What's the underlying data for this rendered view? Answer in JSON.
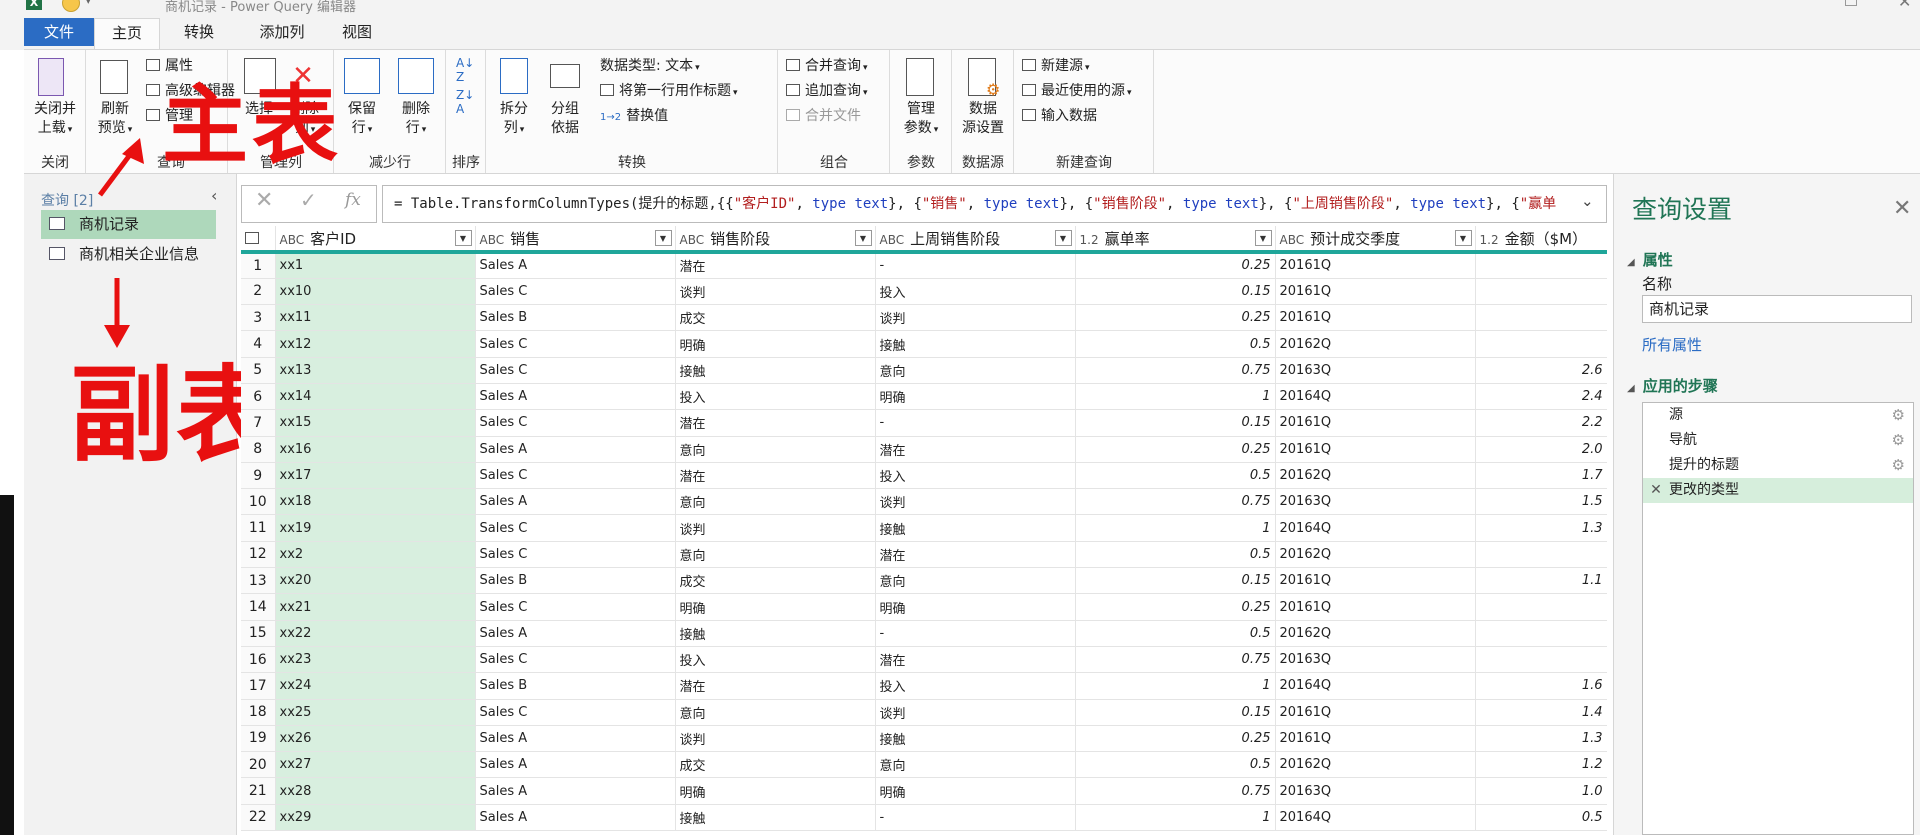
{
  "window": {
    "title": "商机记录 - Power Query 编辑器"
  },
  "tabs": {
    "file": "文件",
    "home": "主页",
    "transform": "转换",
    "add_column": "添加列",
    "view": "视图"
  },
  "ribbon": {
    "close_load": "关闭并",
    "close_load2": "上载",
    "close_group": "关闭",
    "refresh": "刷新",
    "refresh2": "预览",
    "properties": "属性",
    "advanced_editor": "高级编辑器",
    "manage": "管理",
    "choose_cols": "选择",
    "remove_cols": "删除",
    "remove_cols2": "列",
    "keep_rows": "保留",
    "keep_rows2": "行",
    "remove_rows": "删除",
    "remove_rows2": "行",
    "reduce_group": "减少行",
    "sort_group": "排序",
    "split": "拆分",
    "split2": "列",
    "group_by": "分组",
    "group_by2": "依据",
    "data_type": "数据类型: 文本",
    "first_row_header": "将第一行用作标题",
    "replace_values": "替换值",
    "transform_group": "转换",
    "merge_queries": "合并查询",
    "append_queries": "追加查询",
    "combine_files": "合并文件",
    "combine_group": "组合",
    "manage_params": "管理",
    "manage_params2": "参数",
    "params_group": "参数",
    "ds_settings": "数据",
    "ds_settings2": "源设置",
    "ds_group": "数据源",
    "new_source": "新建源",
    "recent_sources": "最近使用的源",
    "enter_data": "输入数据",
    "new_query_group": "新建查询",
    "query_group_partial": "查询",
    "manage_cols_partial": "管理列"
  },
  "annotations": {
    "main": "主表",
    "sub": "副表"
  },
  "queries": {
    "header": "查询 [2]",
    "items": [
      "商机记录",
      "商机相关企业信息"
    ]
  },
  "formula": {
    "prefix": "= Table.TransformColumnTypes(提升的标题,{{",
    "p1": "\"客户ID\"",
    "t1": "type text",
    "p2": "\"销售\"",
    "t2": "type text",
    "p3": "\"销售阶段\"",
    "t3": "type text",
    "p4": "\"上周销售阶段\"",
    "t4": "type text",
    "p5": "\"赢单"
  },
  "grid": {
    "columns": [
      {
        "type": "ABC",
        "name": "客户ID"
      },
      {
        "type": "ABC",
        "name": "销售"
      },
      {
        "type": "ABC",
        "name": "销售阶段"
      },
      {
        "type": "ABC",
        "name": "上周销售阶段"
      },
      {
        "type": "1.2",
        "name": "赢单率"
      },
      {
        "type": "ABC",
        "name": "预计成交季度"
      },
      {
        "type": "1.2",
        "name": "金额（$M）"
      }
    ],
    "rows": [
      [
        "xx1",
        "Sales A",
        "潜在",
        "-",
        "0.25",
        "20161Q",
        ""
      ],
      [
        "xx10",
        "Sales C",
        "谈判",
        "投入",
        "0.15",
        "20161Q",
        ""
      ],
      [
        "xx11",
        "Sales B",
        "成交",
        "谈判",
        "0.25",
        "20161Q",
        ""
      ],
      [
        "xx12",
        "Sales C",
        "明确",
        "接触",
        "0.5",
        "20162Q",
        ""
      ],
      [
        "xx13",
        "Sales C",
        "接触",
        "意向",
        "0.75",
        "20163Q",
        "2.6"
      ],
      [
        "xx14",
        "Sales A",
        "投入",
        "明确",
        "1",
        "20164Q",
        "2.4"
      ],
      [
        "xx15",
        "Sales C",
        "潜在",
        "-",
        "0.15",
        "20161Q",
        "2.2"
      ],
      [
        "xx16",
        "Sales A",
        "意向",
        "潜在",
        "0.25",
        "20161Q",
        "2.0"
      ],
      [
        "xx17",
        "Sales C",
        "潜在",
        "投入",
        "0.5",
        "20162Q",
        "1.7"
      ],
      [
        "xx18",
        "Sales A",
        "意向",
        "谈判",
        "0.75",
        "20163Q",
        "1.5"
      ],
      [
        "xx19",
        "Sales C",
        "谈判",
        "接触",
        "1",
        "20164Q",
        "1.3"
      ],
      [
        "xx2",
        "Sales C",
        "意向",
        "潜在",
        "0.5",
        "20162Q",
        ""
      ],
      [
        "xx20",
        "Sales B",
        "成交",
        "意向",
        "0.15",
        "20161Q",
        "1.1"
      ],
      [
        "xx21",
        "Sales C",
        "明确",
        "明确",
        "0.25",
        "20161Q",
        ""
      ],
      [
        "xx22",
        "Sales A",
        "接触",
        "-",
        "0.5",
        "20162Q",
        ""
      ],
      [
        "xx23",
        "Sales C",
        "投入",
        "潜在",
        "0.75",
        "20163Q",
        ""
      ],
      [
        "xx24",
        "Sales B",
        "潜在",
        "投入",
        "1",
        "20164Q",
        "1.6"
      ],
      [
        "xx25",
        "Sales C",
        "意向",
        "谈判",
        "0.15",
        "20161Q",
        "1.4"
      ],
      [
        "xx26",
        "Sales A",
        "谈判",
        "接触",
        "0.25",
        "20161Q",
        "1.3"
      ],
      [
        "xx27",
        "Sales A",
        "成交",
        "意向",
        "0.5",
        "20162Q",
        "1.2"
      ],
      [
        "xx28",
        "Sales A",
        "明确",
        "明确",
        "0.75",
        "20163Q",
        "1.0"
      ],
      [
        "xx29",
        "Sales A",
        "接触",
        "-",
        "1",
        "20164Q",
        "0.5"
      ]
    ]
  },
  "settings": {
    "title": "查询设置",
    "props_header": "属性",
    "name_label": "名称",
    "name_value": "商机记录",
    "all_props": "所有属性",
    "steps_header": "应用的步骤",
    "steps": [
      "源",
      "导航",
      "提升的标题",
      "更改的类型"
    ]
  }
}
